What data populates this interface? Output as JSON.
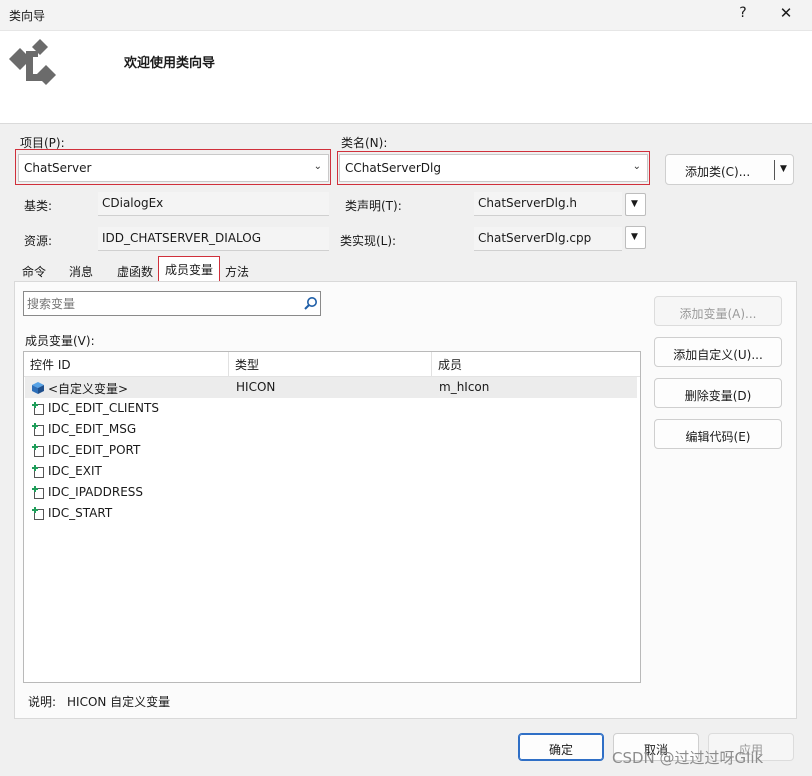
{
  "window": {
    "title": "类向导",
    "help_label": "?",
    "close_label": "✕"
  },
  "header": {
    "heading": "欢迎使用类向导"
  },
  "project": {
    "label": "项目(P):",
    "value": "ChatServer"
  },
  "classname": {
    "label": "类名(N):",
    "value": "CChatServerDlg"
  },
  "add_class_button": "添加类(C)...",
  "base": {
    "label": "基类:",
    "value": "CDialogEx"
  },
  "decl": {
    "label": "类声明(T):",
    "value": "ChatServerDlg.h"
  },
  "resource": {
    "label": "资源:",
    "value": "IDD_CHATSERVER_DIALOG"
  },
  "impl": {
    "label": "类实现(L):",
    "value": "ChatServerDlg.cpp"
  },
  "tabs": [
    {
      "label": "命令"
    },
    {
      "label": "消息"
    },
    {
      "label": "虚函数"
    },
    {
      "label": "成员变量"
    },
    {
      "label": "方法"
    }
  ],
  "active_tab": "成员变量",
  "search": {
    "placeholder": "搜索变量"
  },
  "members_label": "成员变量(V):",
  "table": {
    "columns": [
      "控件 ID",
      "类型",
      "成员"
    ],
    "rows": [
      {
        "id": "<自定义变量>",
        "type": "HICON",
        "member": "m_hIcon",
        "icon": "custom-variable-icon"
      },
      {
        "id": "IDC_EDIT_CLIENTS",
        "type": "",
        "member": "",
        "icon": "control-id-icon"
      },
      {
        "id": "IDC_EDIT_MSG",
        "type": "",
        "member": "",
        "icon": "control-id-icon"
      },
      {
        "id": "IDC_EDIT_PORT",
        "type": "",
        "member": "",
        "icon": "control-id-icon"
      },
      {
        "id": "IDC_EXIT",
        "type": "",
        "member": "",
        "icon": "control-id-icon"
      },
      {
        "id": "IDC_IPADDRESS",
        "type": "",
        "member": "",
        "icon": "control-id-icon"
      },
      {
        "id": "IDC_START",
        "type": "",
        "member": "",
        "icon": "control-id-icon"
      }
    ]
  },
  "side_buttons": {
    "add_variable": "添加变量(A)...",
    "add_custom": "添加自定义(U)...",
    "delete_variable": "删除变量(D)",
    "edit_code": "编辑代码(E)"
  },
  "description": {
    "label": "说明:",
    "value": "HICON 自定义变量"
  },
  "footer": {
    "ok": "确定",
    "cancel": "取消",
    "apply": "应用"
  },
  "watermark": "CSDN @过过过呀Glik",
  "colors": {
    "highlight_red": "#d0303b",
    "primary_blue": "#2f6fc6"
  }
}
